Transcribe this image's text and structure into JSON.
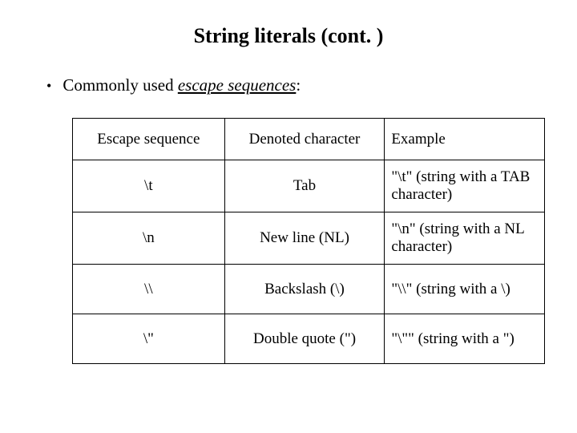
{
  "title": "String literals (cont. )",
  "bullet": {
    "prefix": "Commonly used ",
    "emph": "escape sequences",
    "suffix": ":"
  },
  "table": {
    "headers": {
      "escape": "Escape sequence",
      "denoted": "Denoted character",
      "example": "Example"
    },
    "rows": [
      {
        "escape": "\\t",
        "denoted": "Tab",
        "example": "\"\\t\" (string with a TAB character)"
      },
      {
        "escape": "\\n",
        "denoted": "New line (NL)",
        "example": "\"\\n\" (string with a NL character)"
      },
      {
        "escape": "\\\\",
        "denoted": "Backslash (\\)",
        "example": "\"\\\\\" (string with a \\)"
      },
      {
        "escape": "\\\"",
        "denoted": "Double quote (\")",
        "example": "\"\\\"\" (string with a \")"
      }
    ]
  }
}
